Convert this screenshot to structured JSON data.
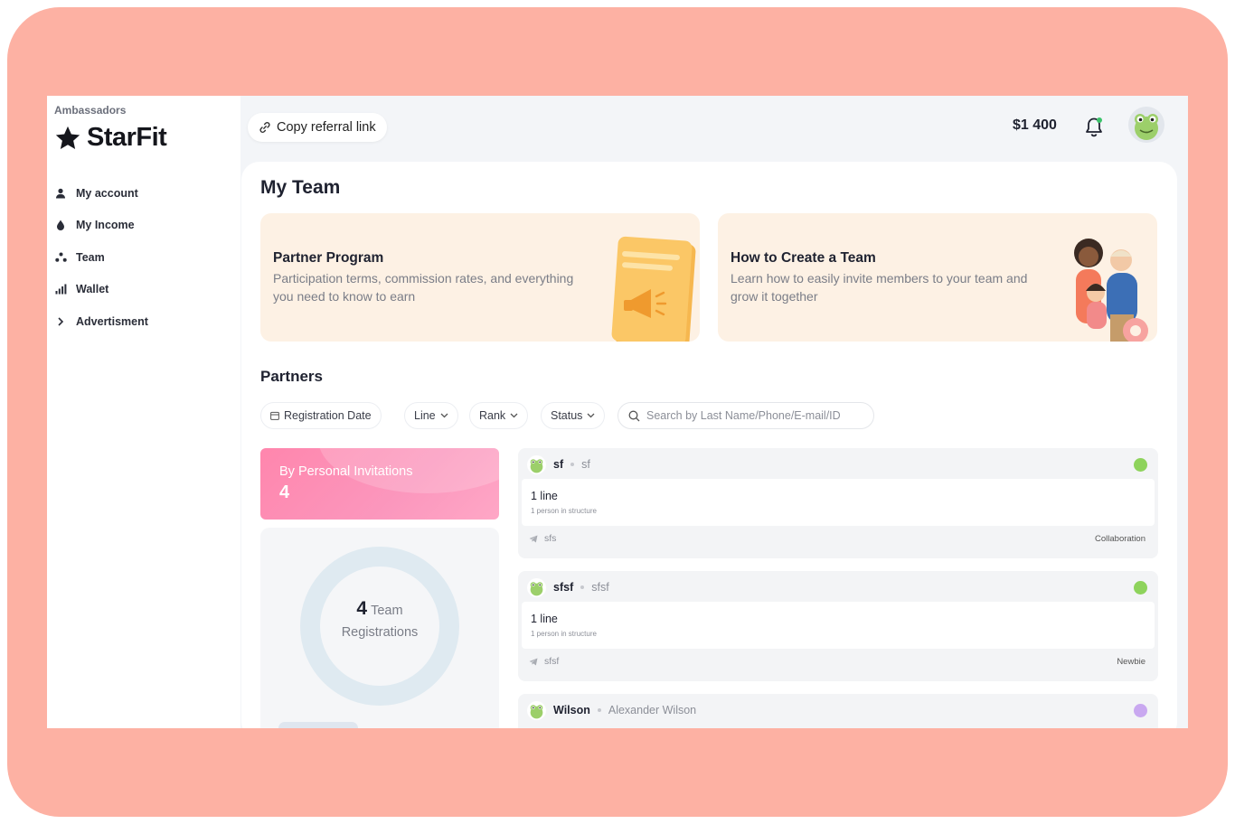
{
  "sidebar": {
    "section_label": "Ambassadors",
    "brand": "StarFit",
    "items": [
      {
        "label": "My account",
        "icon": "user-icon"
      },
      {
        "label": "My Income",
        "icon": "drop-icon"
      },
      {
        "label": "Team",
        "icon": "team-icon"
      },
      {
        "label": "Wallet",
        "icon": "bar-chart-icon"
      },
      {
        "label": "Advertisment",
        "icon": "chevron-right-icon"
      }
    ]
  },
  "header": {
    "copy_referral": "Copy referral link",
    "balance": "$1 400"
  },
  "main": {
    "title": "My Team",
    "promos": [
      {
        "title": "Partner Program",
        "description": "Participation terms, commission rates, and everything you need to know to earn"
      },
      {
        "title": "How to Create a Team",
        "description": "Learn how to easily invite members to your team and grow it together"
      }
    ],
    "partners_title": "Partners",
    "filters": {
      "registration_date": "Registration Date",
      "line": "Line",
      "rank": "Rank",
      "status": "Status"
    },
    "search": {
      "placeholder": "Search by Last Name/Phone/E-mail/ID",
      "value": ""
    },
    "stats": {
      "invitations_label": "By Personal Invitations",
      "invitations_count": "4",
      "team_count": "4",
      "team_label_1": "Team",
      "team_label_2": "Registrations"
    },
    "partners": [
      {
        "nick": "sf",
        "name": "sf",
        "line": "1 line",
        "structure": "1 person in structure",
        "contact": "sfs",
        "rank": "Collaboration",
        "status_color": "#8ed35c"
      },
      {
        "nick": "sfsf",
        "name": "sfsf",
        "line": "1 line",
        "structure": "1 person in structure",
        "contact": "sfsf",
        "rank": "Newbie",
        "status_color": "#8ed35c"
      },
      {
        "nick": "Wilson",
        "name": "Alexander Wilson",
        "line": "",
        "structure": "",
        "contact": "",
        "rank": "",
        "status_color": "#c9a8f0"
      }
    ]
  },
  "colors": {
    "frame": "#fdb1a3",
    "promo_bg": "#fdf1e4",
    "invitation_card": "#ff86ad",
    "donut_ring": "#dfeaf1"
  }
}
